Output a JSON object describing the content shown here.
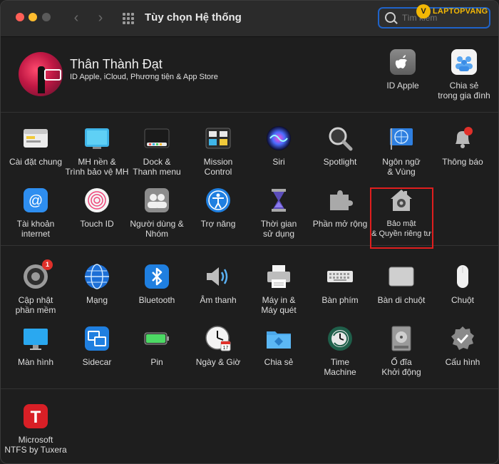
{
  "window": {
    "title": "Tùy chọn Hệ thống"
  },
  "search": {
    "placeholder": "Tìm kiếm"
  },
  "watermark": {
    "text": "LAPTOPVANG"
  },
  "profile": {
    "name": "Thân Thành Đạt",
    "subtitle": "ID Apple, iCloud, Phương tiện & App Store",
    "shortcuts": [
      {
        "label": "ID Apple",
        "icon": "apple-id-icon"
      },
      {
        "label": "Chia sẻ\ntrong gia đình",
        "icon": "family-sharing-icon"
      }
    ]
  },
  "row1": [
    {
      "label": "Cài đặt chung",
      "icon": "general-icon"
    },
    {
      "label": "MH nền &\nTrình bảo vệ MH",
      "icon": "desktop-screensaver-icon"
    },
    {
      "label": "Dock &\nThanh menu",
      "icon": "dock-icon"
    },
    {
      "label": "Mission\nControl",
      "icon": "mission-control-icon"
    },
    {
      "label": "Siri",
      "icon": "siri-icon"
    },
    {
      "label": "Spotlight",
      "icon": "spotlight-icon"
    },
    {
      "label": "Ngôn ngữ\n& Vùng",
      "icon": "language-region-icon"
    },
    {
      "label": "Thông báo",
      "icon": "notifications-icon"
    }
  ],
  "row2": [
    {
      "label": "Tài khoản\ninternet",
      "icon": "internet-accounts-icon"
    },
    {
      "label": "Touch ID",
      "icon": "touch-id-icon"
    },
    {
      "label": "Người dùng &\nNhóm",
      "icon": "users-groups-icon"
    },
    {
      "label": "Trợ năng",
      "icon": "accessibility-icon"
    },
    {
      "label": "Thời gian\nsử dụng",
      "icon": "screen-time-icon"
    },
    {
      "label": "Phần mở rộng",
      "icon": "extensions-icon"
    },
    {
      "label": "Bảo mật\n& Quyền riêng tư",
      "icon": "security-privacy-icon"
    }
  ],
  "row3": [
    {
      "label": "Cập nhật\nphần mềm",
      "icon": "software-update-icon",
      "badge": "1"
    },
    {
      "label": "Mạng",
      "icon": "network-icon"
    },
    {
      "label": "Bluetooth",
      "icon": "bluetooth-icon"
    },
    {
      "label": "Âm thanh",
      "icon": "sound-icon"
    },
    {
      "label": "Máy in &\nMáy quét",
      "icon": "printers-scanners-icon"
    },
    {
      "label": "Bàn phím",
      "icon": "keyboard-icon"
    },
    {
      "label": "Bàn di chuột",
      "icon": "trackpad-icon"
    },
    {
      "label": "Chuột",
      "icon": "mouse-icon"
    }
  ],
  "row4": [
    {
      "label": "Màn hình",
      "icon": "displays-icon"
    },
    {
      "label": "Sidecar",
      "icon": "sidecar-icon"
    },
    {
      "label": "Pin",
      "icon": "battery-icon"
    },
    {
      "label": "Ngày & Giờ",
      "icon": "date-time-icon"
    },
    {
      "label": "Chia sẻ",
      "icon": "sharing-icon"
    },
    {
      "label": "Time\nMachine",
      "icon": "time-machine-icon"
    },
    {
      "label": "Ổ đĩa\nKhởi động",
      "icon": "startup-disk-icon"
    },
    {
      "label": "Cấu hình",
      "icon": "profiles-icon"
    }
  ],
  "row5": [
    {
      "label": "Microsoft\nNTFS by Tuxera",
      "icon": "ntfs-tuxera-icon"
    }
  ]
}
